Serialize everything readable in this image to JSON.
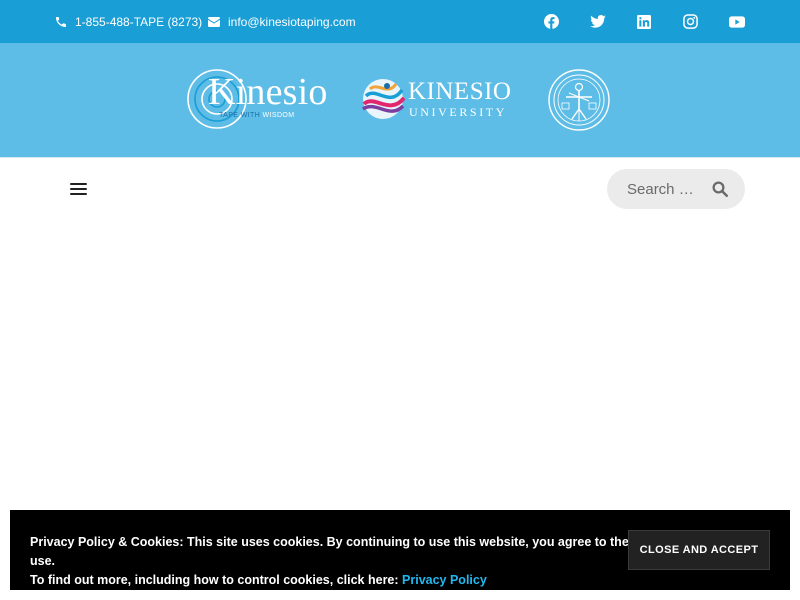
{
  "topbar": {
    "phone": "1-855-488-TAPE (8273)",
    "email": "info@kinesiotaping.com",
    "social": [
      "facebook-icon",
      "twitter-icon",
      "linkedin-icon",
      "instagram-icon",
      "youtube-icon"
    ],
    "bg_color": "#1a9ed6"
  },
  "logos": {
    "kinesio_word": "Kinesio",
    "kinesio_tag_left": "TAPE WITH ",
    "kinesio_tag_right": "WISDOM",
    "university_line1": "KINESIO",
    "university_line2": "UNIVERSITY",
    "band_color": "#5ebde6"
  },
  "nav": {
    "search_placeholder": "Search …"
  },
  "cookie": {
    "line1": "Privacy Policy & Cookies: This site uses cookies. By continuing to use this website, you agree to their use.",
    "line2": "To find out more, including how to control cookies, click here: ",
    "link": "Privacy Policy",
    "button": "CLOSE AND ACCEPT",
    "link_color": "#22b8f0"
  }
}
